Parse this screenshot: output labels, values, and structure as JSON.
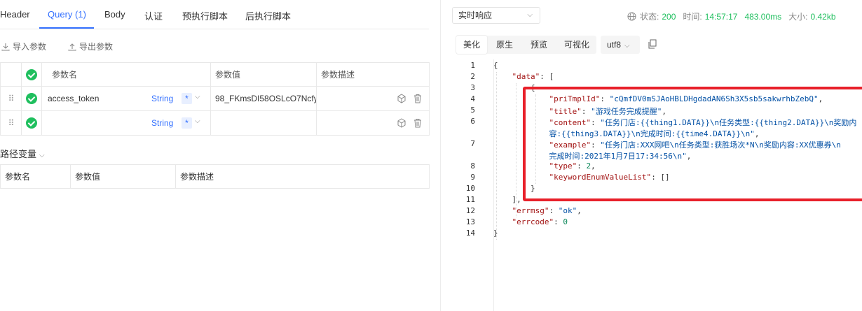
{
  "request_tabs": [
    "Header",
    "Query (1)",
    "Body",
    "认证",
    "预执行脚本",
    "后执行脚本"
  ],
  "actions": {
    "import": "导入参数",
    "export": "导出参数"
  },
  "params_table": {
    "headers": [
      "参数名",
      "参数值",
      "参数描述"
    ],
    "rows": [
      {
        "name": "access_token",
        "type": "String",
        "required": "*",
        "value": "98_FKmsDI58OSLcO7Ncfy",
        "desc": ""
      },
      {
        "name": "",
        "type": "String",
        "required": "*",
        "value": "",
        "desc": ""
      }
    ]
  },
  "path_vars": {
    "title": "路径变量",
    "headers": [
      "参数名",
      "参数值",
      "参数描述"
    ]
  },
  "response": {
    "mode": "实时响应",
    "status_label": "状态:",
    "status_code": "200",
    "time_label": "时间:",
    "time": "14:57:17",
    "duration": "483.00ms",
    "size_label": "大小:",
    "size": "0.42kb",
    "view_tabs": [
      "美化",
      "原生",
      "预览",
      "可视化"
    ],
    "encoding": "utf8"
  },
  "json_body": {
    "line_numbers": [
      "1",
      "2",
      "3",
      "4",
      "5",
      "6",
      "7",
      "8",
      "9",
      "10",
      "11",
      "12",
      "13",
      "14"
    ],
    "pri_tmpl_id": "\"cQmfDV0mSJAoHBLDHgdadAN6Sh3X5sb5sakwrhbZebQ\"",
    "title": "\"游戏任务完成提醒\"",
    "content_1": "\"任务门店:{{thing1.DATA}}\\n任务类型:{{thing2.DATA}}\\n奖励内",
    "content_2": "容:{{thing3.DATA}}\\n完成时间:{{time4.DATA}}\\n\"",
    "example_1": "\"任务门店:XXX网吧\\n任务类型:获胜场次*N\\n奖励内容:XX优惠券\\n",
    "example_2": "完成时间:2021年1月7日17:34:56\\n\"",
    "type": "2",
    "errmsg": "\"ok\"",
    "errcode": "0"
  }
}
